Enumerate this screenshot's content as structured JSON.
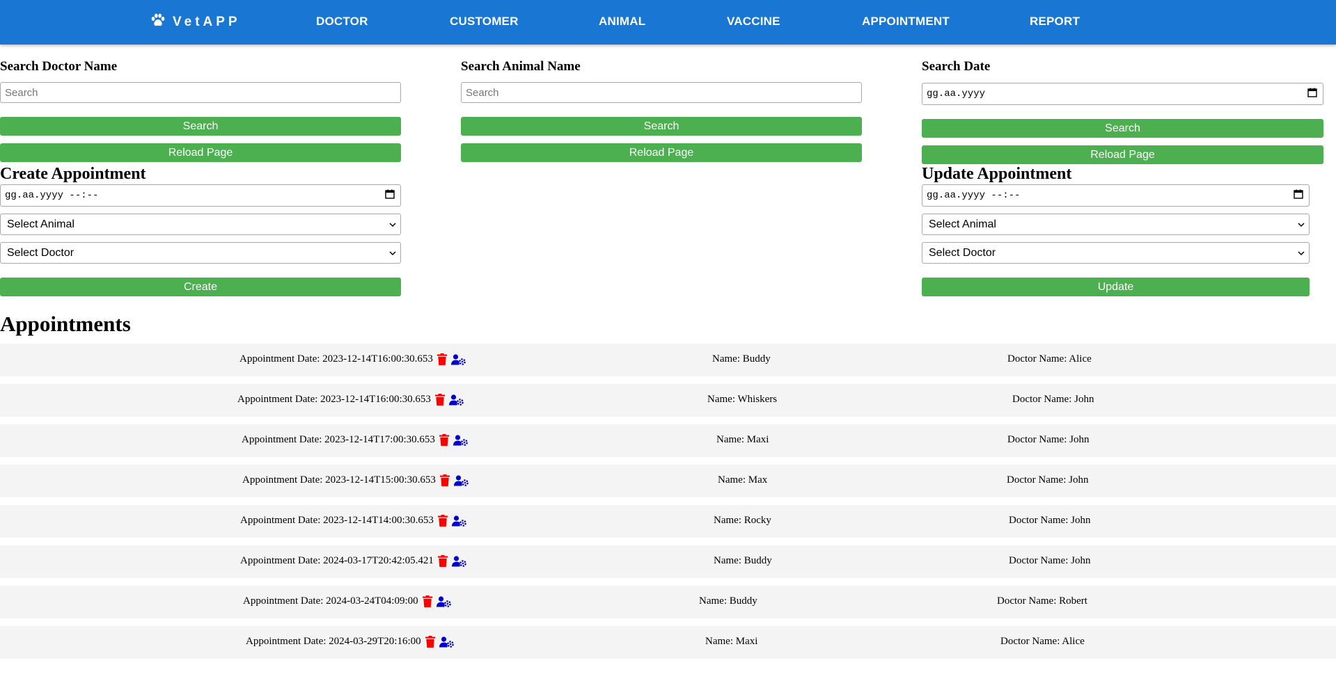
{
  "navbar": {
    "brand": "VetAPP",
    "items": [
      {
        "label": "DOCTOR"
      },
      {
        "label": "CUSTOMER"
      },
      {
        "label": "ANIMAL"
      },
      {
        "label": "VACCINE"
      },
      {
        "label": "APPOINTMENT"
      },
      {
        "label": "REPORT"
      }
    ]
  },
  "search_doctor": {
    "title": "Search Doctor Name",
    "placeholder": "Search",
    "search_label": "Search",
    "reload_label": "Reload Page"
  },
  "search_animal": {
    "title": "Search Animal Name",
    "placeholder": "Search",
    "search_label": "Search",
    "reload_label": "Reload Page"
  },
  "search_date": {
    "title": "Search Date",
    "date_value": "gg.aa.yyyy",
    "search_label": "Search",
    "reload_label": "Reload Page"
  },
  "create": {
    "title": "Create Appointment",
    "datetime_value": "gg.aa.yyyy --:--",
    "animal_select": "Select Animal",
    "doctor_select": "Select Doctor",
    "button_label": "Create"
  },
  "update": {
    "title": "Update Appointment",
    "datetime_value": "gg.aa.yyyy --:--",
    "animal_select": "Select Animal",
    "doctor_select": "Select Doctor",
    "button_label": "Update"
  },
  "appointments": {
    "title": "Appointments",
    "rows": [
      {
        "date": "Appointment Date: 2023-12-14T16:00:30.653",
        "name": "Name: Buddy",
        "doctor": "Doctor Name: Alice"
      },
      {
        "date": "Appointment Date: 2023-12-14T16:00:30.653",
        "name": "Name: Whiskers",
        "doctor": "Doctor Name: John"
      },
      {
        "date": "Appointment Date: 2023-12-14T17:00:30.653",
        "name": "Name: Maxi",
        "doctor": "Doctor Name: John"
      },
      {
        "date": "Appointment Date: 2023-12-14T15:00:30.653",
        "name": "Name: Max",
        "doctor": "Doctor Name: John"
      },
      {
        "date": "Appointment Date: 2023-12-14T14:00:30.653",
        "name": "Name: Rocky",
        "doctor": "Doctor Name: John"
      },
      {
        "date": "Appointment Date: 2024-03-17T20:42:05.421",
        "name": "Name: Buddy",
        "doctor": "Doctor Name: John"
      },
      {
        "date": "Appointment Date: 2024-03-24T04:09:00",
        "name": "Name: Buddy",
        "doctor": "Doctor Name: Robert"
      },
      {
        "date": "Appointment Date: 2024-03-29T20:16:00",
        "name": "Name: Maxi",
        "doctor": "Doctor Name: Alice"
      }
    ]
  },
  "colors": {
    "navbar": "#1976d2",
    "button": "#4caf50",
    "row_bg": "#f4f4f4",
    "delete_icon": "#ff0000",
    "edit_icon": "#0000cc"
  },
  "icons": {
    "brand": "paw-icon",
    "delete": "trash-icon",
    "edit": "user-gear-icon",
    "date_picker": "calendar-icon",
    "select": "chevron-down-icon"
  }
}
